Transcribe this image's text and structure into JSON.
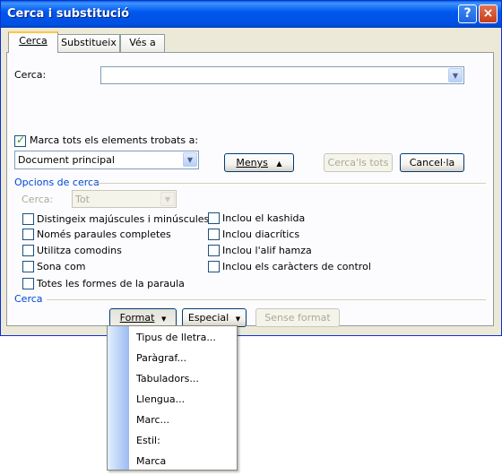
{
  "window": {
    "title": "Cerca i substitució",
    "help_button": "?",
    "close_button": "×"
  },
  "tabs": [
    {
      "label": "Cerca",
      "active": true
    },
    {
      "label": "Substitueix",
      "active": false
    },
    {
      "label": "Vés a",
      "active": false
    }
  ],
  "search": {
    "label": "Cerca:",
    "value": ""
  },
  "highlight_all": {
    "label": "Marca tots els elements trobats a:",
    "checked": true,
    "scope_value": "Document principal"
  },
  "buttons": {
    "less": "Menys",
    "less_arrow": "▲",
    "find_all": "Cerca'ls tots",
    "cancel": "Cancel·la"
  },
  "options": {
    "title": "Opcions de cerca",
    "search_direction_label": "Cerca:",
    "search_direction_value": "Tot",
    "left_checks": [
      {
        "label": "Distingeix majúscules i minúscules",
        "checked": false
      },
      {
        "label": "Només paraules completes",
        "checked": false
      },
      {
        "label": "Utilitza comodins",
        "checked": false
      },
      {
        "label": "Sona com",
        "checked": false
      },
      {
        "label": "Totes les formes de la paraula",
        "checked": false
      }
    ],
    "right_checks": [
      {
        "label": "Inclou el kashida",
        "checked": false
      },
      {
        "label": "Inclou diacrítics",
        "checked": false
      },
      {
        "label": "Inclou l'alif hamza",
        "checked": false
      },
      {
        "label": "Inclou els caràcters de control",
        "checked": false
      }
    ]
  },
  "find_section": {
    "title": "Cerca",
    "format": "Format",
    "special": "Especial",
    "no_formatting": "Sense format"
  },
  "format_menu": {
    "items": [
      "Tipus de lletra...",
      "Paràgraf...",
      "Tabuladors...",
      "Llengua...",
      "Marc...",
      "Estil:",
      "Marca"
    ]
  },
  "colors": {
    "titlebar": "#0058ee",
    "dialog_bg": "#ece9d8",
    "group_title": "#0046d5",
    "check_mark": "#21a121"
  }
}
